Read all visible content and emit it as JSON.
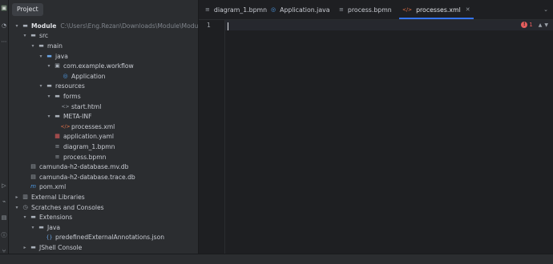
{
  "toolstrip": {
    "icons": [
      {
        "name": "project-icon",
        "glyph": "▣"
      },
      {
        "name": "commit-icon",
        "glyph": "◔"
      },
      {
        "name": "more-icon",
        "glyph": "⋯"
      },
      {
        "name": "run-icon",
        "glyph": "▷"
      },
      {
        "name": "plugin-icon",
        "glyph": "⌁"
      },
      {
        "name": "terminal-icon",
        "glyph": "▤"
      },
      {
        "name": "problems-icon",
        "glyph": "ⓘ"
      },
      {
        "name": "git-icon",
        "glyph": "⑂"
      }
    ]
  },
  "project_panel": {
    "tab_label": "Project"
  },
  "tree": [
    {
      "label": "Module",
      "path": "C:\\Users\\Eng.Rezan\\Downloads\\Module\\Module",
      "icon": "folder",
      "expanded": true,
      "bold": true
    },
    {
      "label": "src",
      "icon": "folder",
      "expanded": true
    },
    {
      "label": "main",
      "icon": "folder",
      "expanded": true
    },
    {
      "label": "java",
      "icon": "folder-blue",
      "expanded": true
    },
    {
      "label": "com.example.workflow",
      "icon": "package",
      "expanded": true
    },
    {
      "label": "Application",
      "icon": "class"
    },
    {
      "label": "resources",
      "icon": "folder",
      "expanded": true
    },
    {
      "label": "forms",
      "icon": "folder",
      "expanded": true
    },
    {
      "label": "start.html",
      "icon": "html"
    },
    {
      "label": "META-INF",
      "icon": "folder",
      "expanded": true
    },
    {
      "label": "processes.xml",
      "icon": "xml"
    },
    {
      "label": "application.yaml",
      "icon": "yaml"
    },
    {
      "label": "diagram_1.bpmn",
      "icon": "file"
    },
    {
      "label": "process.bpmn",
      "icon": "file"
    },
    {
      "label": "camunda-h2-database.mv.db",
      "icon": "db"
    },
    {
      "label": "camunda-h2-database.trace.db",
      "icon": "db"
    },
    {
      "label": "pom.xml",
      "icon": "maven"
    },
    {
      "label": "External Libraries",
      "icon": "library",
      "expanded": false
    },
    {
      "label": "Scratches and Consoles",
      "icon": "scratch",
      "expanded": true
    },
    {
      "label": "Extensions",
      "icon": "folder",
      "expanded": true
    },
    {
      "label": "Java",
      "icon": "folder",
      "expanded": true
    },
    {
      "label": "predefinedExternalAnnotations.json",
      "icon": "json"
    },
    {
      "label": "JShell Console",
      "icon": "folder",
      "expanded": false
    }
  ],
  "editor": {
    "tabs": [
      {
        "label": "diagram_1.bpmn",
        "icon": "file",
        "active": false
      },
      {
        "label": "Application.java",
        "icon": "class",
        "active": false
      },
      {
        "label": "process.bpmn",
        "icon": "file",
        "active": false
      },
      {
        "label": "processes.xml",
        "icon": "xml",
        "active": true
      }
    ],
    "line_number": "1",
    "error_count": "1",
    "error_mark": "!"
  },
  "colors": {
    "accent": "#3574f0",
    "error": "#e55d5d",
    "background": "#1e1f22",
    "panel": "#2b2d30"
  }
}
